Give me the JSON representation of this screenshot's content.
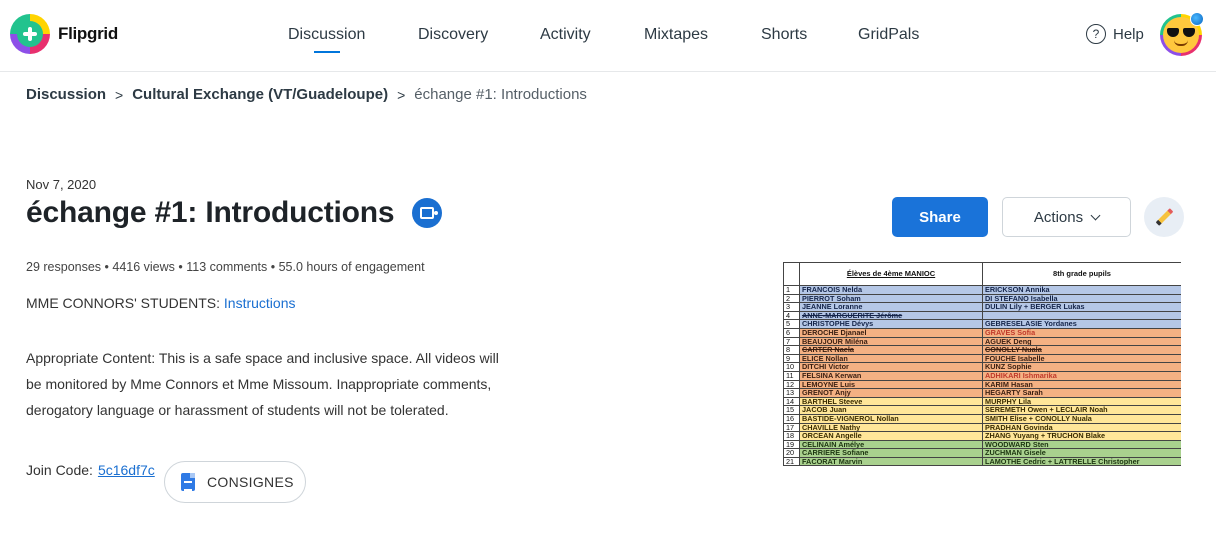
{
  "app": {
    "name": "Flipgrid"
  },
  "nav": {
    "items": [
      {
        "label": "Discussion",
        "active": true
      },
      {
        "label": "Discovery",
        "active": false
      },
      {
        "label": "Activity",
        "active": false
      },
      {
        "label": "Mixtapes",
        "active": false
      },
      {
        "label": "Shorts",
        "active": false
      },
      {
        "label": "GridPals",
        "active": false
      }
    ],
    "help_label": "Help"
  },
  "breadcrumb": {
    "root": "Discussion",
    "group": "Cultural Exchange (VT/Guadeloupe)",
    "current": "échange #1: Introductions",
    "separator": ">"
  },
  "topic": {
    "date": "Nov 7, 2020",
    "title": "échange #1: Introductions",
    "stats": "29 responses • 4416 views • 113 comments • 55.0 hours of engagement",
    "instructions_prefix": "MME CONNORS' STUDENTS: ",
    "instructions_link": "Instructions",
    "content_lines": [
      "Appropriate Content: This is a safe space and inclusive space. All videos will",
      "be monitored by Mme Connors et Mme Missoum. Inappropriate comments,",
      "derogatory language or harassment of students will not be tolerated."
    ],
    "join_label": "Join Code:",
    "join_code": "5c16df7c",
    "attachment_label": "CONSIGNES"
  },
  "actions": {
    "share_label": "Share",
    "actions_label": "Actions",
    "edit_icon": "pencil-icon"
  },
  "sheet": {
    "header_left": "Élèves de 4ème MANIOC",
    "header_right": "8th grade pupils",
    "rows": [
      {
        "n": "1",
        "left": "FRANCOIS Nelda",
        "right": "ERICKSON Annika",
        "color": "blue"
      },
      {
        "n": "2",
        "left": "PIERROT Soham",
        "right": "DI STEFANO Isabella",
        "color": "blue"
      },
      {
        "n": "3",
        "left": "JEANNE Loranne",
        "right": "DULIN Lily + BERGER Lukas",
        "color": "blue"
      },
      {
        "n": "4",
        "left": "ANNE-MARGUERITE Jérôme",
        "right": "",
        "color": "blue",
        "strike_left": true
      },
      {
        "n": "5",
        "left": "CHRISTOPHE Dévys",
        "right": "GEBRESELASIE Yordanes",
        "color": "blue"
      },
      {
        "n": "6",
        "left": "DEROCHE Djanael",
        "right": "GRAVES Sofia",
        "color": "orange",
        "red_right": true
      },
      {
        "n": "7",
        "left": "BEAUJOUR Miléna",
        "right": "AGUEK Deng",
        "color": "orange"
      },
      {
        "n": "8",
        "left": "CARTER Naela",
        "right": "CONOLLY Nuala",
        "color": "orange",
        "strike_left": true,
        "strike_right": true
      },
      {
        "n": "9",
        "left": "ELICE Nollan",
        "right": "FOUCHE Isabelle",
        "color": "orange"
      },
      {
        "n": "10",
        "left": "DITCHI Victor",
        "right": "KUNZ Sophie",
        "color": "orange"
      },
      {
        "n": "11",
        "left": "FELSINA Kerwan",
        "right": "ADHIKARI Ishmarika",
        "color": "orange",
        "red_right": true
      },
      {
        "n": "12",
        "left": "LEMOYNE Luis",
        "right": "KARIM Hasan",
        "color": "orange"
      },
      {
        "n": "13",
        "left": "GRENOT Anjy",
        "right": "HEGARTY Sarah",
        "color": "orange"
      },
      {
        "n": "14",
        "left": "BARTHEL Steeve",
        "right": "MURPHY Lila",
        "color": "yellow"
      },
      {
        "n": "15",
        "left": "JACOB Juan",
        "right": "SEREMETH Owen + LECLAIR Noah",
        "color": "yellow"
      },
      {
        "n": "16",
        "left": "BASTIDE-VIGNEROL Nollan",
        "right": "SMITH Elise + CONOLLY Nuala",
        "color": "yellow"
      },
      {
        "n": "17",
        "left": "CHAVILLE Nathy",
        "right": "PRADHAN Govinda",
        "color": "yellow"
      },
      {
        "n": "18",
        "left": "ORCEAN Angelle",
        "right": "ZHANG Yuyang + TRUCHON Blake",
        "color": "yellow"
      },
      {
        "n": "19",
        "left": "CELINAIN Amélye",
        "right": "WOODWARD Sten",
        "color": "green"
      },
      {
        "n": "20",
        "left": "CARRIERE Sofiane",
        "right": "ZUCHMAN Gisele",
        "color": "green"
      },
      {
        "n": "21",
        "left": "FACORAT Marvin",
        "right": "LAMOTHE Cedric + LATTRELLE Christopher",
        "color": "green"
      }
    ]
  },
  "colors": {
    "accent": "#0075db",
    "share": "#1a73d9",
    "blue_row": "#b5c7e6",
    "orange_row": "#f4b183",
    "yellow_row": "#ffe699",
    "green_row": "#a9d18e"
  }
}
